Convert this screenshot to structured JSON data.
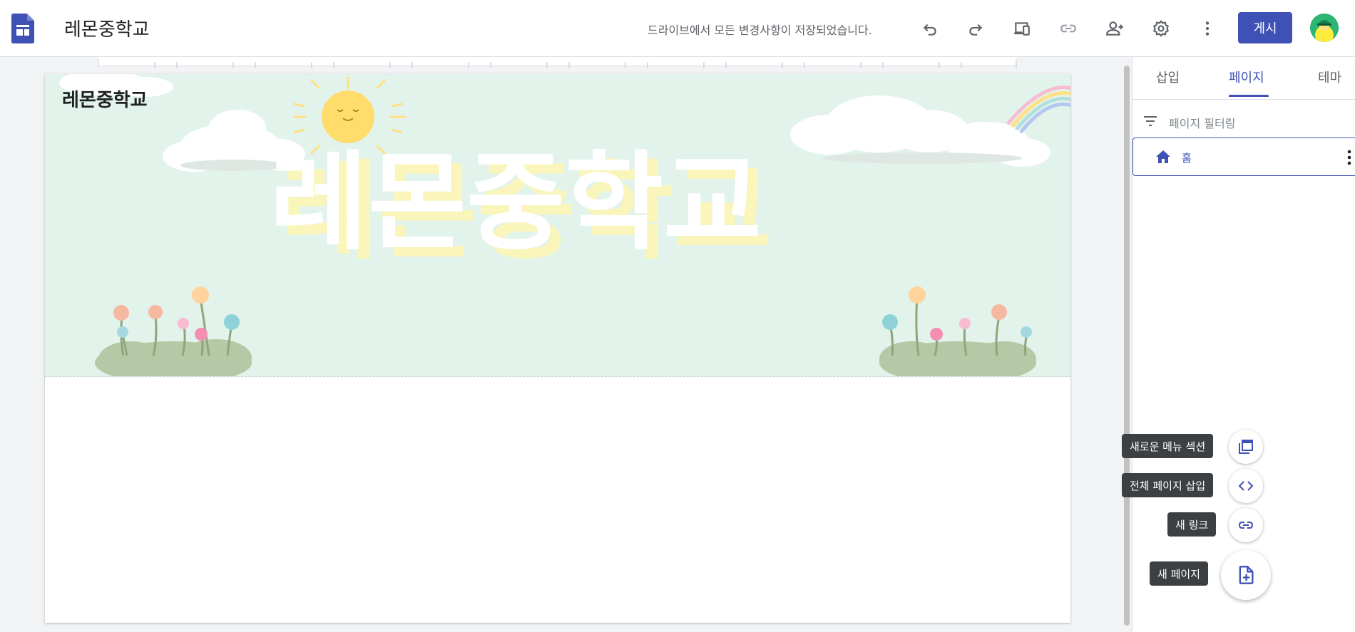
{
  "app": {
    "site_title": "레몬중학교",
    "save_status": "드라이브에서 모든 변경사항이 저장되었습니다.",
    "publish_label": "게시",
    "brand_color": "#3f51b5"
  },
  "toolbar": {
    "icons": [
      "undo-icon",
      "redo-icon",
      "preview-devices-icon",
      "link-icon",
      "add-person-icon",
      "gear-icon",
      "more-vert-icon"
    ]
  },
  "canvas": {
    "header_site_name": "레몬중학교",
    "banner_text": "레몬중학교",
    "banner_color": "#e2f3ec"
  },
  "panel": {
    "tabs": [
      {
        "label": "삽입",
        "active": false
      },
      {
        "label": "페이지",
        "active": true
      },
      {
        "label": "테마",
        "active": false
      }
    ],
    "filter_placeholder": "페이지 필터링",
    "pages": [
      {
        "label": "홈",
        "icon": "home-icon"
      }
    ]
  },
  "fab_menu": {
    "new_menu_section": "새로운 메뉴 섹션",
    "full_page_embed": "전체 페이지 삽입",
    "new_link": "새 링크",
    "new_page": "새 페이지"
  }
}
